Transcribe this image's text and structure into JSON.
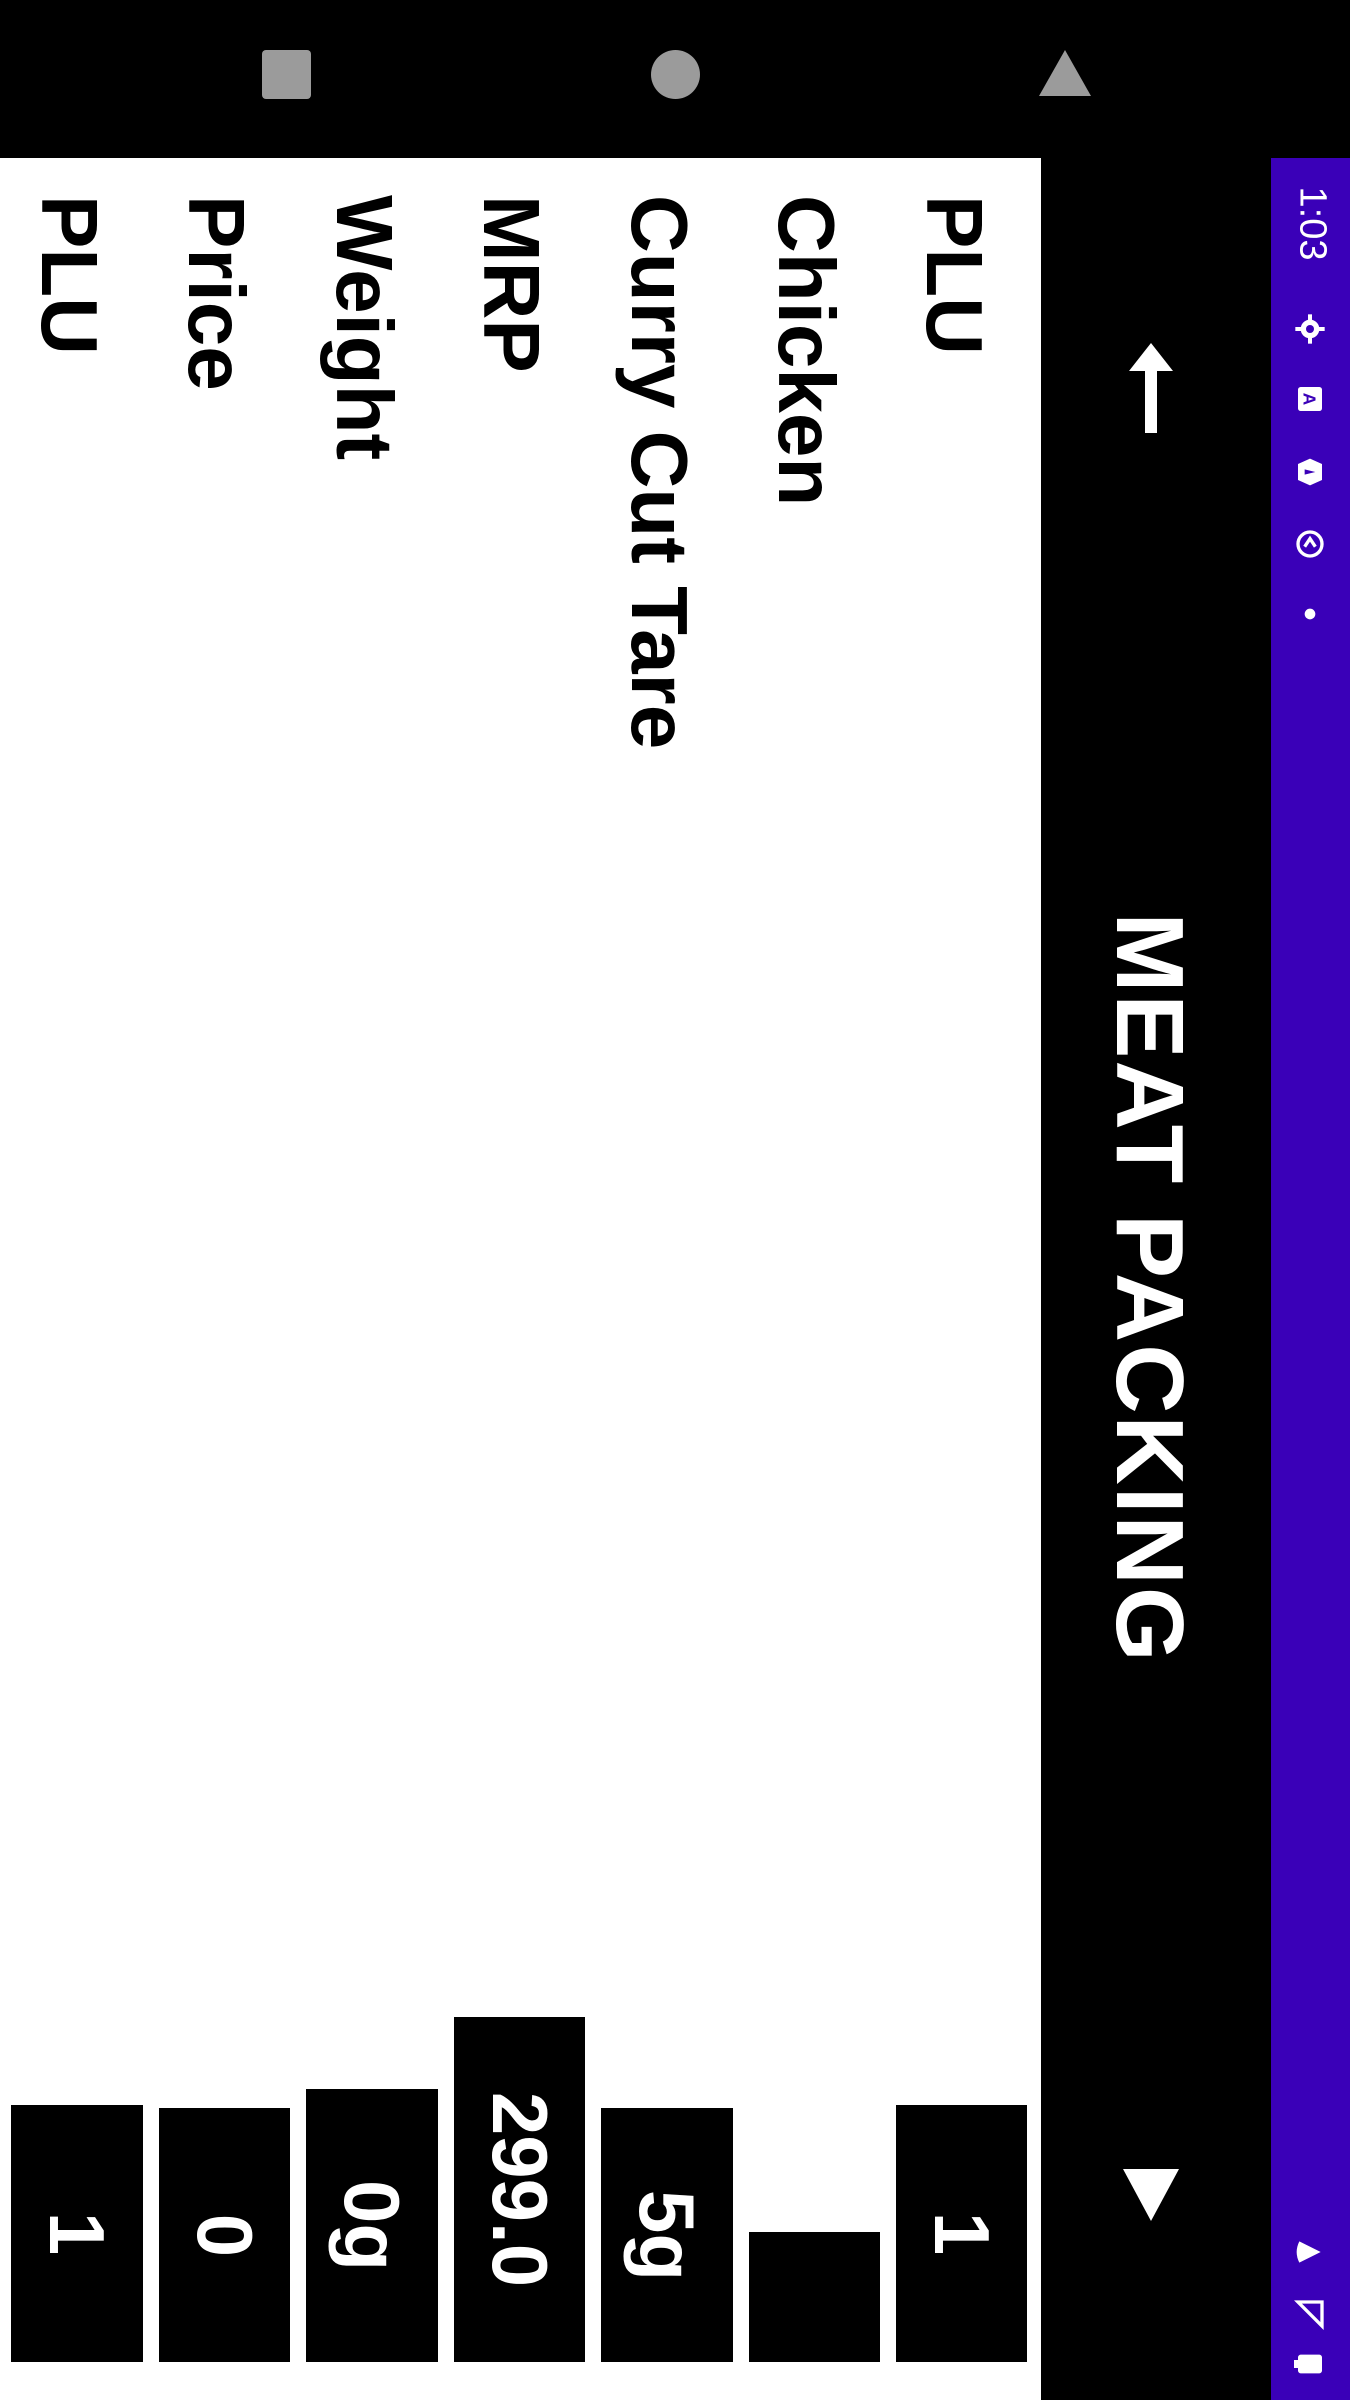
{
  "status_bar": {
    "time": "1:03",
    "icons": [
      "gear-icon",
      "app-a-icon",
      "shield-icon",
      "sync-icon",
      "dot-icon",
      "wifi-icon",
      "signal-icon",
      "battery-icon"
    ]
  },
  "app_bar": {
    "title": "MEAT PACKING",
    "up_icon": "arrow-up-icon",
    "down_icon": "dropdown-triangle-icon"
  },
  "fields": [
    {
      "label": "PLU",
      "value": "1"
    },
    {
      "label": "Chicken",
      "value": ""
    },
    {
      "label": "Curry Cut Tare",
      "value": "5g"
    },
    {
      "label": "MRP",
      "value": "299.0"
    },
    {
      "label": "Weight",
      "value": "0g"
    },
    {
      "label": "Price",
      "value": "0"
    },
    {
      "label": "PLU",
      "value": "1"
    }
  ],
  "colors": {
    "status_bar": "#3a00b8",
    "app_bar": "#000000",
    "nav_bar": "#000000",
    "value_box": "#000000"
  }
}
